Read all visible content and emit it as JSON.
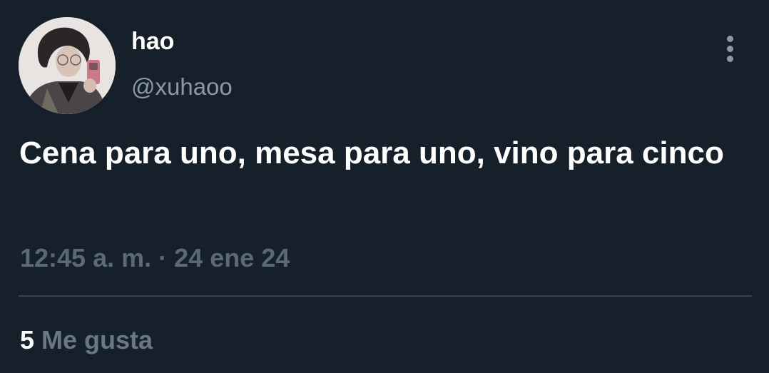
{
  "user": {
    "display_name": "hao",
    "handle": "@xuhaoo"
  },
  "tweet": {
    "text": "Cena para uno, mesa para uno, vino para cinco",
    "time": "12:45 a. m.",
    "separator": "·",
    "date": "24 ene 24"
  },
  "engagement": {
    "likes_count": "5",
    "likes_label": "Me gusta"
  },
  "icons": {
    "menu": "more-vertical-icon"
  },
  "colors": {
    "background": "#15202b",
    "primary_text": "#ffffff",
    "secondary_text": "#8b98a5",
    "divider": "#38444d"
  }
}
